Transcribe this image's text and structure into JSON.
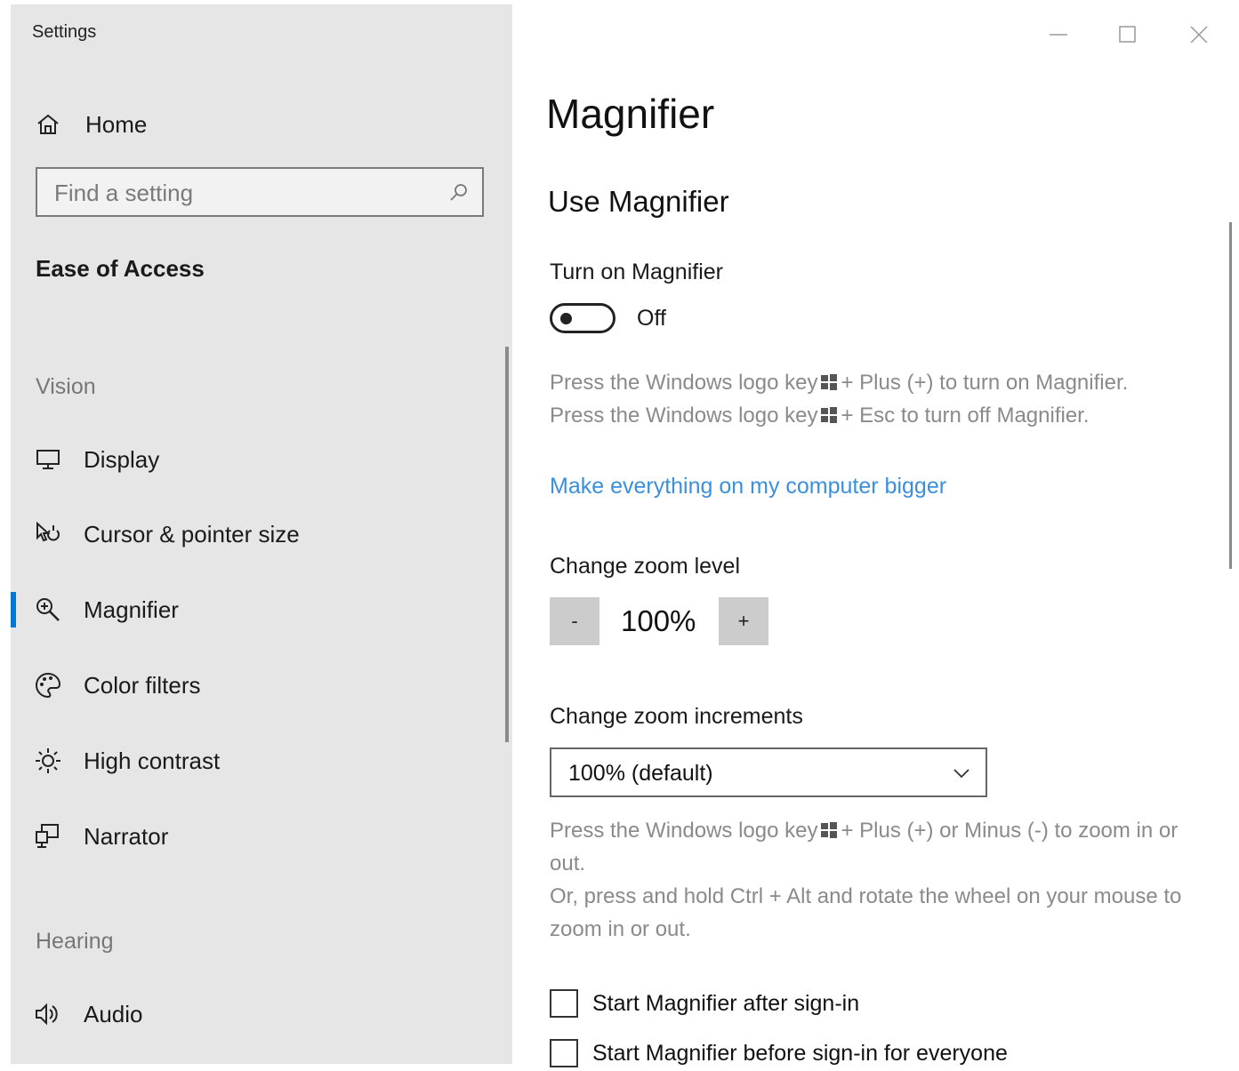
{
  "window": {
    "title": "Settings",
    "controls": [
      "minimize",
      "maximize",
      "close"
    ]
  },
  "sidebar": {
    "home_label": "Home",
    "search_placeholder": "Find a setting",
    "section_title": "Ease of Access",
    "groups": [
      {
        "header": "Vision",
        "items": [
          {
            "label": "Display",
            "icon": "display-icon"
          },
          {
            "label": "Cursor & pointer size",
            "icon": "cursor-icon"
          },
          {
            "label": "Magnifier",
            "icon": "magnifier-icon",
            "selected": true
          },
          {
            "label": "Color filters",
            "icon": "color-filters-icon"
          },
          {
            "label": "High contrast",
            "icon": "high-contrast-icon"
          },
          {
            "label": "Narrator",
            "icon": "narrator-icon"
          }
        ]
      },
      {
        "header": "Hearing",
        "items": [
          {
            "label": "Audio",
            "icon": "audio-icon"
          }
        ]
      }
    ]
  },
  "main": {
    "title": "Magnifier",
    "section": "Use Magnifier",
    "toggle": {
      "label": "Turn on Magnifier",
      "state": "Off"
    },
    "shortcut_help": {
      "line1_before": "Press the Windows logo key",
      "line1_after": "+ Plus (+) to turn on Magnifier.",
      "line2_before": "Press the Windows logo key",
      "line2_after": "+ Esc to turn off Magnifier."
    },
    "link": "Make everything on my computer bigger",
    "zoom": {
      "label": "Change zoom level",
      "minus": "-",
      "value": "100%",
      "plus": "+"
    },
    "increments": {
      "label": "Change zoom increments",
      "value": "100% (default)"
    },
    "zoom_help": {
      "para1_before": "Press the Windows logo key",
      "para1_after": "+ Plus (+) or Minus (-) to zoom in or out.",
      "para2": "Or, press and hold Ctrl + Alt and rotate the wheel on your mouse to zoom in or out."
    },
    "checkboxes": [
      {
        "label": "Start Magnifier after sign-in",
        "checked": false
      },
      {
        "label": "Start Magnifier before sign-in for everyone",
        "checked": false
      }
    ]
  },
  "colors": {
    "accent": "#0078d7",
    "link": "#3a8fde",
    "sidebar_bg": "#e6e6e6"
  }
}
